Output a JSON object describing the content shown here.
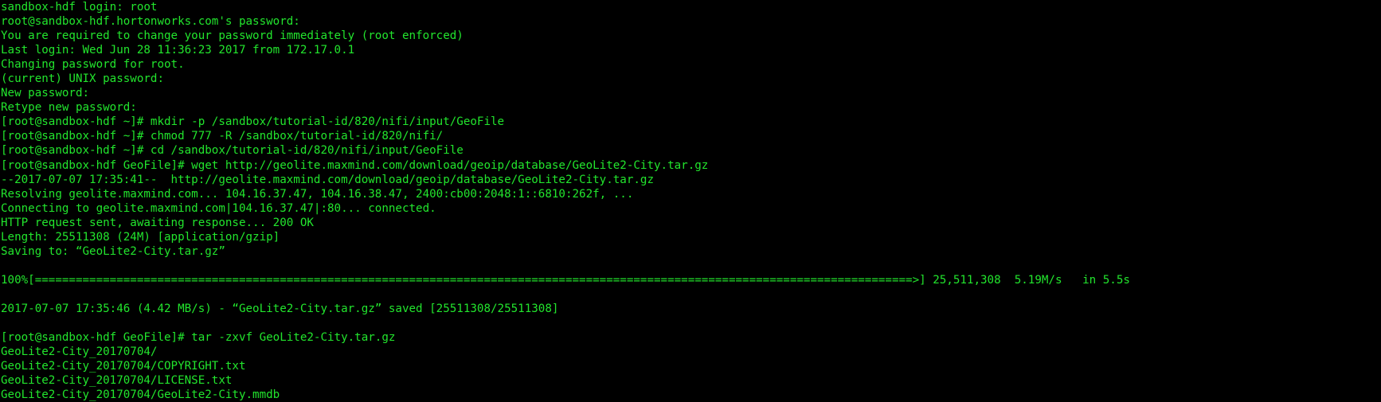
{
  "terminal": {
    "lines": [
      "sandbox-hdf login: root",
      "root@sandbox-hdf.hortonworks.com's password:",
      "You are required to change your password immediately (root enforced)",
      "Last login: Wed Jun 28 11:36:23 2017 from 172.17.0.1",
      "Changing password for root.",
      "(current) UNIX password:",
      "New password:",
      "Retype new password:",
      "[root@sandbox-hdf ~]# mkdir -p /sandbox/tutorial-id/820/nifi/input/GeoFile",
      "[root@sandbox-hdf ~]# chmod 777 -R /sandbox/tutorial-id/820/nifi/",
      "[root@sandbox-hdf ~]# cd /sandbox/tutorial-id/820/nifi/input/GeoFile",
      "[root@sandbox-hdf GeoFile]# wget http://geolite.maxmind.com/download/geoip/database/GeoLite2-City.tar.gz",
      "--2017-07-07 17:35:41--  http://geolite.maxmind.com/download/geoip/database/GeoLite2-City.tar.gz",
      "Resolving geolite.maxmind.com... 104.16.37.47, 104.16.38.47, 2400:cb00:2048:1::6810:262f, ...",
      "Connecting to geolite.maxmind.com|104.16.37.47|:80... connected.",
      "HTTP request sent, awaiting response... 200 OK",
      "Length: 25511308 (24M) [application/gzip]",
      "Saving to: “GeoLite2-City.tar.gz”",
      "",
      "100%[=================================================================================================================================>] 25,511,308  5.19M/s   in 5.5s",
      "",
      "2017-07-07 17:35:46 (4.42 MB/s) - “GeoLite2-City.tar.gz” saved [25511308/25511308]",
      "",
      "[root@sandbox-hdf GeoFile]# tar -zxvf GeoLite2-City.tar.gz",
      "GeoLite2-City_20170704/",
      "GeoLite2-City_20170704/COPYRIGHT.txt",
      "GeoLite2-City_20170704/LICENSE.txt",
      "GeoLite2-City_20170704/GeoLite2-City.mmdb"
    ]
  },
  "colors": {
    "background": "#000000",
    "text": "#22e52d"
  }
}
